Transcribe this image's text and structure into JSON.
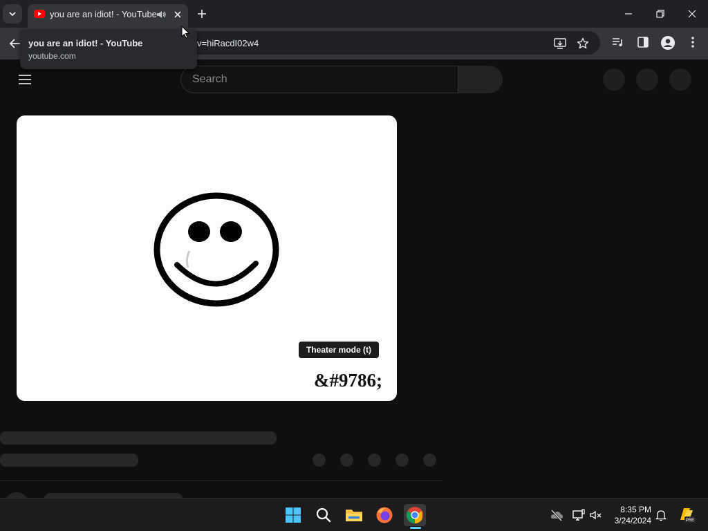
{
  "browser": {
    "tab": {
      "title": "you are an idiot! - YouTube",
      "favicon": "youtube-icon"
    },
    "omnibox": {
      "url_visible": "v=hiRacdI02w4"
    },
    "hovercard": {
      "title": "you are an idiot! - YouTube",
      "domain": "youtube.com"
    }
  },
  "youtube": {
    "search_placeholder": "Search",
    "player": {
      "tooltip": "Theater mode (t)",
      "caption": "&#9786;"
    }
  },
  "taskbar": {
    "apps": [
      "windows-start-icon",
      "search-icon",
      "file-explorer-icon",
      "firefox-icon",
      "chrome-icon"
    ],
    "active_app": "chrome-icon",
    "time": "8:35 PM",
    "date": "3/24/2024"
  },
  "colors": {
    "youtube_red": "#ff0000",
    "chrome_bg": "#202124",
    "toolbar_bg": "#35363a",
    "page_bg": "#0f0f0f",
    "accent_blue": "#60cdff"
  }
}
